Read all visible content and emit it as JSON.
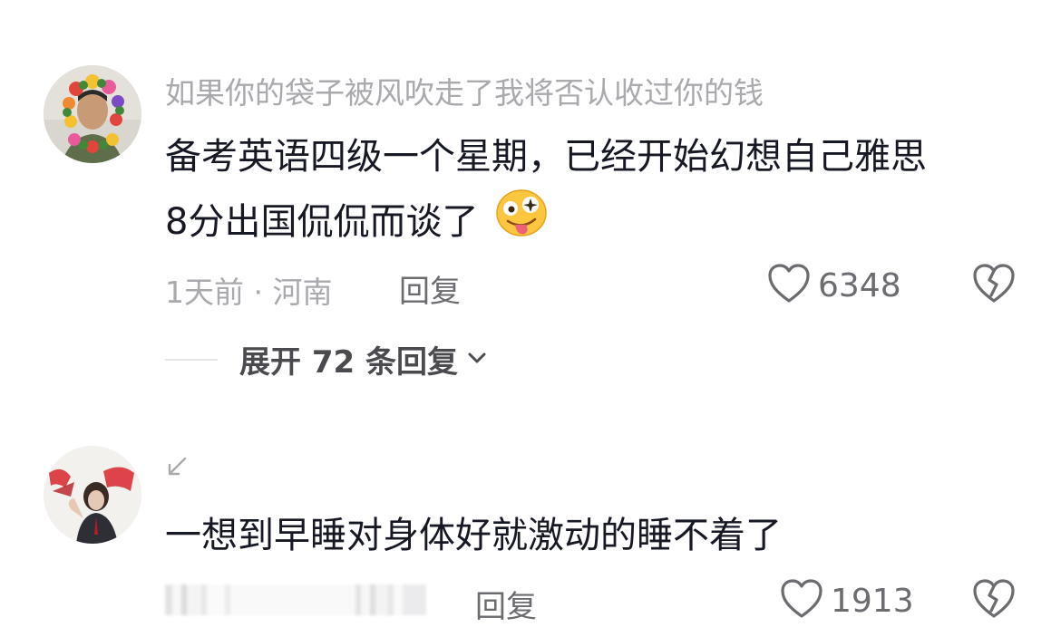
{
  "comments": [
    {
      "username": "如果你的袋子被风吹走了我将否认收过你的钱",
      "text_lines": [
        "备考英语四级一个星期，已经开始幻想自己雅思",
        "8分出国侃侃而谈了"
      ],
      "emoji": "drooling-face-emoji",
      "time_location": "1天前 · 河南",
      "reply_label": "回复",
      "likes": "6348",
      "expand_replies": "展开 72 条回复"
    },
    {
      "text": "一想到早睡对身体好就激动的睡不着了",
      "reply_label": "回复",
      "likes": "1913"
    }
  ],
  "colors": {
    "text_primary": "#161823",
    "text_secondary": "#a9a9ae",
    "icon_gray": "#6b6b70"
  }
}
